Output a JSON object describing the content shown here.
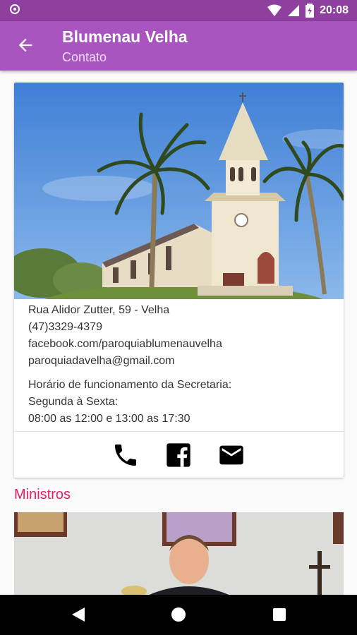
{
  "status_bar": {
    "time": "20:08",
    "icons": [
      "notification-icon",
      "wifi-icon",
      "signal-icon",
      "battery-icon"
    ]
  },
  "app_bar": {
    "title": "Blumenau Velha",
    "subtitle": "Contato",
    "back_icon": "arrow-left-icon",
    "color": "#a855c0"
  },
  "contact_card": {
    "address": "Rua Alidor Zutter, 59 - Velha",
    "phone": "(47)3329-4379",
    "facebook": "facebook.com/paroquiablumenauvelha",
    "email": "paroquiadavelha@gmail.com",
    "hours_title": "Horário de funcionamento da Secretaria:",
    "hours_days": "Segunda à Sexta:",
    "hours_times": "08:00 as 12:00 e 13:00 as 17:30",
    "actions": [
      "phone-icon",
      "facebook-icon",
      "email-icon"
    ]
  },
  "ministers_section": {
    "title": "Ministros",
    "color": "#e91e63"
  },
  "nav_bar": {
    "buttons": [
      "back-triangle-icon",
      "home-circle-icon",
      "recents-square-icon"
    ]
  }
}
